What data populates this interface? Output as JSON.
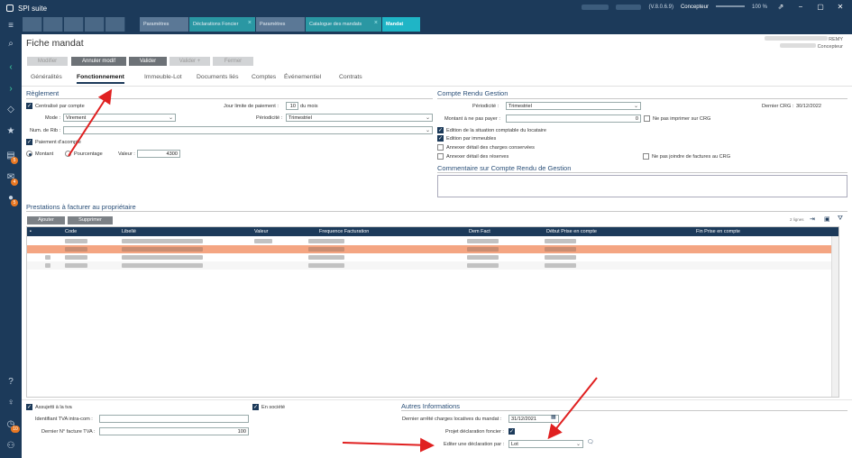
{
  "app": {
    "title": "SPI suite",
    "version": "(V.8.0.6.9)",
    "role": "Concepteur",
    "zoom": "100 %"
  },
  "window_controls": {
    "pin": "⇗",
    "minimize": "−",
    "maximize": "▢",
    "close": "✕"
  },
  "doc_tabs": [
    {
      "label": "Paramètres"
    },
    {
      "label": "Déclarations Foncier",
      "closable": true
    },
    {
      "label": "Paramètres"
    },
    {
      "label": "Catalogue des mandats",
      "closable": true
    },
    {
      "label": "Mandat",
      "active": true
    }
  ],
  "sidebar": {
    "badges": [
      "5",
      "4",
      "5",
      "10"
    ]
  },
  "page": {
    "title": "Fiche mandat",
    "user_line1": "REMY",
    "user_line2": "Concepteur"
  },
  "toolbar": {
    "modifier": "Modifier",
    "annuler": "Annuler modif",
    "valider": "Valider",
    "valider_plus": "Valider +",
    "fermer": "Fermer"
  },
  "form_tabs": [
    "Généralités",
    "Fonctionnement",
    "Immeuble-Lot",
    "Documents liés",
    "Comptes",
    "Événementiel",
    "Contrats"
  ],
  "reglement": {
    "title": "Règlement",
    "centralise": "Centralisé par compte",
    "jour_limite_label": "Jour limite de paiement :",
    "jour_limite_value": "10",
    "du_mois": "du mois",
    "mode_label": "Mode :",
    "mode_value": "Virement",
    "periodicite_label": "Périodicité :",
    "periodicite_value": "Trimestriel",
    "rib_label": "Num. de Rib :",
    "paiement_acompte": "Paiement d'acompte",
    "montant": "Montant",
    "pourcentage": "Pourcentage",
    "valeur_label": "Valeur :",
    "valeur_value": "4300"
  },
  "crg": {
    "title": "Compte Rendu Gestion",
    "periodicite_label": "Périodicité :",
    "periodicite_value": "Trimestriel",
    "dernier_crg_label": "Dernier CRG :",
    "dernier_crg_value": "30/12/2022",
    "montant_label": "Montant à ne pas payer :",
    "montant_value": "0",
    "ne_pas_imprimer": "Ne pas imprimer sur CRG",
    "edition_situation": "Edition de la situation comptable du locataire",
    "edition_immeubles": "Edition par immeubles",
    "annexer_charges": "Annexer détail des charges conservées",
    "annexer_reserves": "Annexer détail des réserves",
    "ne_pas_joindre": "Ne pas joindre de factures au CRG",
    "commentaire_title": "Commentaire sur Compte Rendu de Gestion"
  },
  "prestations": {
    "title": "Prestations à facturer au propriétaire",
    "ajouter": "Ajouter",
    "supprimer": "Supprimer",
    "count": "2 lignes",
    "columns": [
      "Code",
      "Libellé",
      "Valeur",
      "Frequence Facturation",
      "Dem Fact",
      "Début Prise en compte",
      "Fin Prise en compte"
    ]
  },
  "bottom": {
    "assujetti": "Assujetti à la tva",
    "en_societe": "En société",
    "tva_label": "Identifiant TVA intra-com :",
    "tva_value": "",
    "facture_label": "Dernier N° facture TVA :",
    "facture_value": "100",
    "autres_title": "Autres Informations",
    "arrete_label": "Dernier arrêté charges locatives du mandat :",
    "arrete_value": "31/12/2021",
    "projet_label": "Projet déclaration foncier :",
    "editer_label": "Editer une déclaration par :",
    "editer_value": "Lot"
  },
  "colors": {
    "navy": "#1c3a5a",
    "teal": "#1fb5c6",
    "annotation": "#e02020"
  }
}
